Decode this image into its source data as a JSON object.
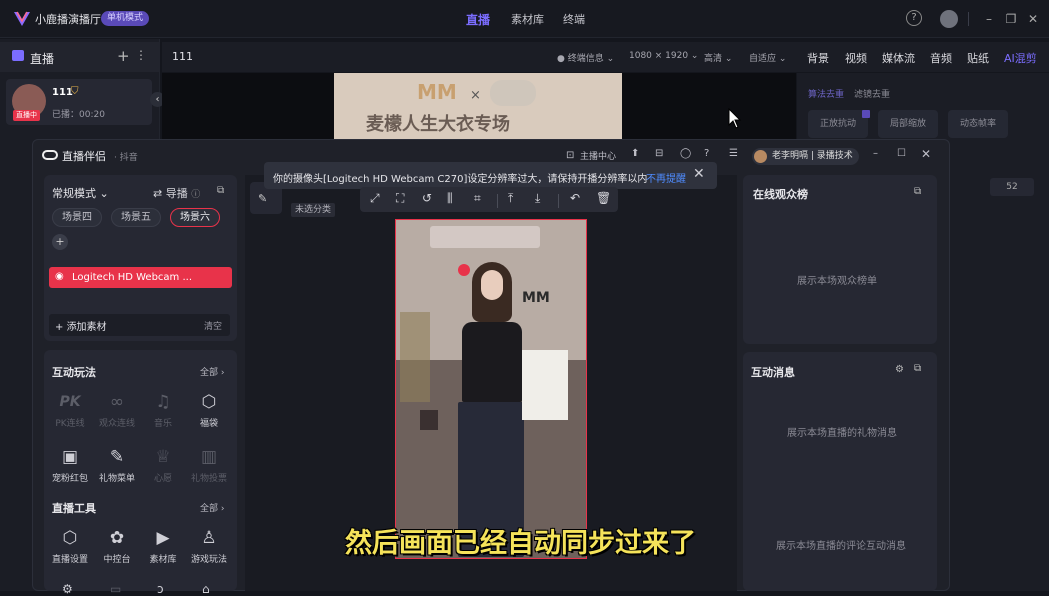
{
  "app": {
    "name": "小鹿播演播厅",
    "mode_badge": "单机模式",
    "nav": [
      "直播",
      "素材库",
      "终端"
    ],
    "window_icons": [
      "help-icon",
      "user-icon",
      "minimize-icon",
      "restore-icon",
      "close-icon"
    ]
  },
  "sidebar": {
    "title": "直播",
    "room": {
      "live_badge": "直播中",
      "name": "111",
      "elapsed": "已播：00:20"
    }
  },
  "toolbar": {
    "title": "111",
    "info": "● 终端信息 ⌄",
    "resolution": "1080 × 1920 ⌄",
    "quality": "高清 ⌄",
    "adapt": "自适应 ⌄",
    "right_tabs": [
      "背景",
      "视频",
      "媒体流",
      "音频",
      "贴纸",
      "AI混剪"
    ]
  },
  "preview": {
    "banner_logo": "MM",
    "banner_x": "×",
    "banner_text": "麦檬人生大衣专场"
  },
  "right_bg": {
    "tab1": "算法去重",
    "tab2": "滤镜去重",
    "buttons": [
      "正放抗动",
      "局部缩放",
      "动态帧率"
    ],
    "value": "52"
  },
  "companion": {
    "title": "直播伴侣",
    "subtitle": "· 抖音",
    "host_center": "主播中心",
    "user": "老李明嗝 | 录播技术",
    "mode": "常规模式",
    "guide": "导播",
    "scenes": [
      "场景四",
      "场景五",
      "场景六"
    ],
    "add_scene": "+",
    "source": "Logitech HD Webcam ...",
    "add_material": "添加素材",
    "clear": "清空",
    "unsorted": "未选分类",
    "interact": {
      "title": "互动玩法",
      "all": "全部 ›",
      "items": [
        {
          "label": "PK连线",
          "icon": "pk-icon",
          "active": false
        },
        {
          "label": "观众连线",
          "icon": "audience-link-icon",
          "active": false
        },
        {
          "label": "音乐",
          "icon": "music-icon",
          "active": false
        },
        {
          "label": "福袋",
          "icon": "lucky-bag-icon",
          "active": true
        },
        {
          "label": "宠粉红包",
          "icon": "red-packet-icon",
          "active": true
        },
        {
          "label": "礼物菜单",
          "icon": "gift-menu-icon",
          "active": true
        },
        {
          "label": "心愿",
          "icon": "wish-icon",
          "active": false
        },
        {
          "label": "礼物投票",
          "icon": "gift-vote-icon",
          "active": false
        }
      ]
    },
    "tools": {
      "title": "直播工具",
      "all": "全部 ›",
      "items": [
        {
          "label": "直播设置",
          "icon": "settings-icon"
        },
        {
          "label": "中控台",
          "icon": "console-icon"
        },
        {
          "label": "素材库",
          "icon": "library-icon"
        },
        {
          "label": "游戏玩法",
          "icon": "game-icon"
        }
      ]
    },
    "warning": {
      "text": "你的摄像头[Logitech HD Webcam C270]设定分辨率过大，请保持开播分辨率以内",
      "link": "不再提醒"
    },
    "audience": {
      "title": "在线观众榜",
      "empty": "展示本场观众榜单"
    },
    "messages": {
      "title": "互动消息",
      "gift_empty": "展示本场直播的礼物消息",
      "comment_empty": "展示本场直播的评论互动消息"
    },
    "frame_logo": "MM"
  },
  "caption": "然后画面已经自动同步过来了",
  "colors": {
    "accent": "#7b6dff",
    "live_red": "#e8334a",
    "link_blue": "#4f8cff",
    "caption_yellow": "#f5e35a"
  }
}
